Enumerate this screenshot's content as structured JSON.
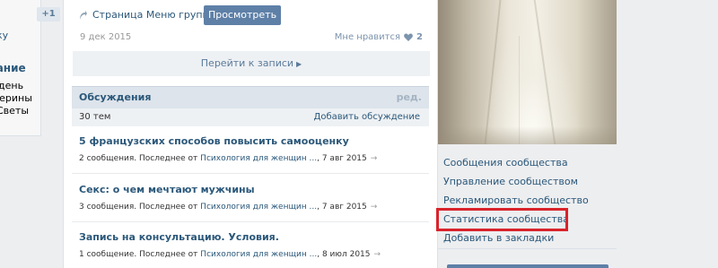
{
  "left_column": {
    "badge": "+1",
    "text_top": "енку",
    "heading": "дание",
    "lines": [
      "день",
      "атерины",
      "Светы",
      "ей"
    ]
  },
  "post": {
    "source_label": "Страница Меню группы",
    "view_button": "Просмотреть",
    "date": "9 дек 2015",
    "likes_label": "Мне нравится",
    "likes_count": "2",
    "goto_label": "Перейти к записи"
  },
  "discussions": {
    "title": "Обсуждения",
    "edit_label": "ред.",
    "count": "30 тем",
    "add_label": "Добавить обсуждение",
    "topics": [
      {
        "title": "5 французских способов повысить самооценку",
        "meta_count": "2 сообщения. Последнее от",
        "meta_author": "Психология для женщин ...",
        "meta_date": ", 7 авг 2015"
      },
      {
        "title": "Секс: о чем мечтают мужчины",
        "meta_count": "3 сообщения. Последнее от",
        "meta_author": "Психология для женщин ...",
        "meta_date": ", 7 авг 2015"
      },
      {
        "title": "Запись на консультацию. Условия.",
        "meta_count": "1 сообщение. Последнее от",
        "meta_author": "Психология для женщин ...",
        "meta_date": ", 8 июл 2015"
      }
    ]
  },
  "side_menu": {
    "items": [
      "Сообщения сообщества",
      "Управление сообществом",
      "Рекламировать сообщество",
      "Статистика сообщества",
      "Добавить в закладки"
    ],
    "highlight_color": "#d9232b"
  },
  "icons": {
    "repost": "repost-arrow-icon",
    "heart": "heart-icon",
    "arrow_right": "arrow-right-icon"
  },
  "colors": {
    "link": "#2b587a",
    "button": "#5e80a7",
    "background": "#edeef0"
  }
}
